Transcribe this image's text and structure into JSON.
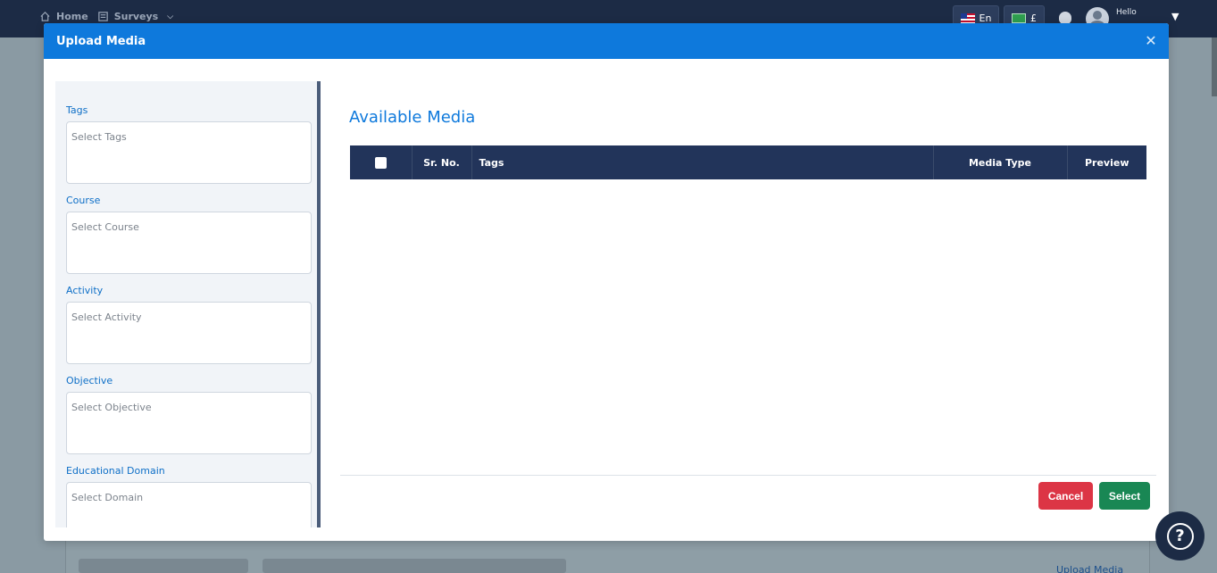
{
  "background": {
    "nav": {
      "home_label": "Home",
      "surveys_label": "Surveys"
    },
    "lang": {
      "label": "En"
    },
    "currency": {
      "label": "£"
    },
    "user": {
      "greeting": "Hello"
    },
    "upload_link": "Upload Media"
  },
  "modal": {
    "title": "Upload Media",
    "filters": [
      {
        "label": "Tags",
        "placeholder": "Select Tags"
      },
      {
        "label": "Course",
        "placeholder": "Select Course"
      },
      {
        "label": "Activity",
        "placeholder": "Select Activity"
      },
      {
        "label": "Objective",
        "placeholder": "Select Objective"
      },
      {
        "label": "Educational Domain",
        "placeholder": "Select Domain"
      }
    ],
    "available_title": "Available Media",
    "table": {
      "columns": [
        "",
        "Sr. No.",
        "Tags",
        "Media Type",
        "Preview"
      ],
      "rows": []
    },
    "buttons": {
      "cancel": "Cancel",
      "select": "Select"
    }
  },
  "help": {
    "icon": "?"
  },
  "colors": {
    "header_blue": "#0e79dc",
    "table_header": "#22345a",
    "cancel_red": "#dc3545",
    "select_green": "#198754",
    "topbar": "#1c2b45"
  }
}
